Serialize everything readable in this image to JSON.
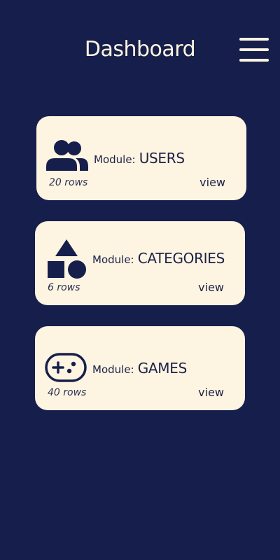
{
  "header": {
    "title": "Dashboard",
    "menu_icon": "hamburger-menu-icon"
  },
  "modules": [
    {
      "icon": "users-icon",
      "prefix": "Module:",
      "name": "USERS",
      "rows": "20 rows",
      "view_label": "view"
    },
    {
      "icon": "shapes-icon",
      "prefix": "Module:",
      "name": "CATEGORIES",
      "rows": "6 rows",
      "view_label": "view"
    },
    {
      "icon": "gamepad-icon",
      "prefix": "Module:",
      "name": "GAMES",
      "rows": "40 rows",
      "view_label": "view"
    }
  ],
  "colors": {
    "background": "#161f4b",
    "card": "#fdf4e1",
    "text_dark": "#1b2147",
    "text_light": "#fdf4e1"
  }
}
